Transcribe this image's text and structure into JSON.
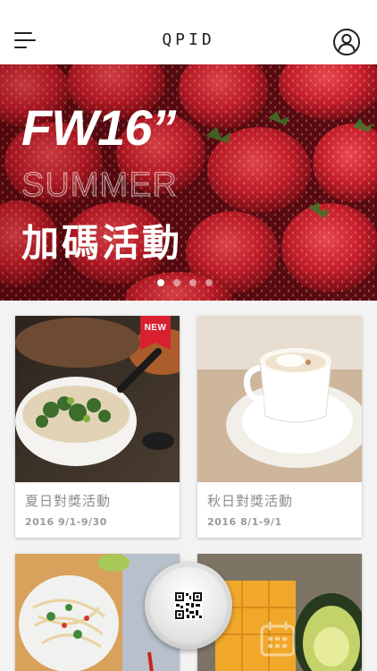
{
  "header": {
    "logo": "QPID",
    "menu_icon": "hamburger-menu-icon",
    "profile_icon": "user-profile-icon"
  },
  "banner": {
    "title": "FW16”",
    "subtitle": "SUMMER",
    "headline_cn": "加碼活動",
    "slide_count": 4,
    "active_slide": 1
  },
  "cards": [
    {
      "title": "夏日對獎活動",
      "date": "2016 9/1-9/30",
      "badge": "NEW"
    },
    {
      "title": "秋日對獎活動",
      "date": "2016 8/1-9/1"
    }
  ],
  "fab": {
    "icon": "qr-code-icon"
  },
  "colors": {
    "accent_red": "#d8202f",
    "text_gray": "#8d8d8d",
    "background": "#f3f3f3"
  }
}
